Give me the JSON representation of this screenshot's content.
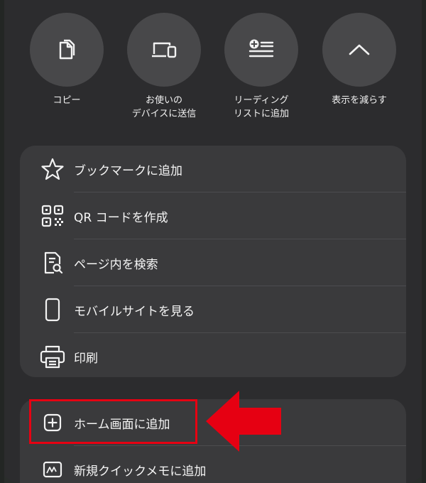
{
  "quick_actions": [
    {
      "icon": "copy-icon",
      "label": "コピー"
    },
    {
      "icon": "send-to-devices-icon",
      "label": "お使いの\nデバイスに送信"
    },
    {
      "icon": "add-to-reading-list-icon",
      "label": "リーディング\nリストに追加"
    },
    {
      "icon": "chevron-up-icon",
      "label": "表示を減らす"
    }
  ],
  "menu_main": [
    {
      "icon": "star-icon",
      "label": "ブックマークに追加"
    },
    {
      "icon": "qr-code-icon",
      "label": "QR コードを作成"
    },
    {
      "icon": "find-in-page-icon",
      "label": "ページ内を検索"
    },
    {
      "icon": "mobile-site-icon",
      "label": "モバイルサイトを見る"
    },
    {
      "icon": "print-icon",
      "label": "印刷"
    }
  ],
  "menu_secondary": [
    {
      "icon": "add-square-icon",
      "label": "ホーム画面に追加"
    },
    {
      "icon": "quick-note-icon",
      "label": "新規クイックメモに追加"
    }
  ],
  "annotation": {
    "highlight_color": "#e60012",
    "arrow_color": "#e60012"
  }
}
